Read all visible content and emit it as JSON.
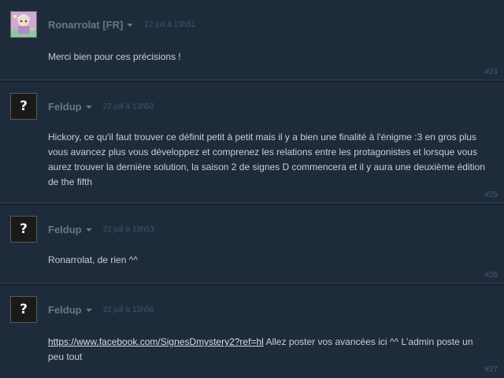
{
  "posts": [
    {
      "author": "Ronarrolat [FR]",
      "timestamp": "22 juil à 13h51",
      "body": "Merci bien pour ces précisions !",
      "number": "#24",
      "avatar": "character-avatar"
    },
    {
      "author": "Feldup",
      "timestamp": "22 juil à 13h53",
      "body": "Hickory, ce qu'il faut trouver ce définit petit à petit mais il y a bien une finalité à l'énigme :3 en gros plus vous avancez plus vous développez et comprenez les relations entre les protagonistes et lorsque vous aurez trouver la dernière solution, la saison 2 de signes D commencera et il y aura une deuxième édition de the fifth",
      "number": "#25",
      "avatar": "question-mark-avatar",
      "avatar_glyph": "?"
    },
    {
      "author": "Feldup",
      "timestamp": "22 juil à 13h53",
      "body": "Ronarrolat, de rien ^^",
      "number": "#26",
      "avatar": "question-mark-avatar",
      "avatar_glyph": "?"
    },
    {
      "author": "Feldup",
      "timestamp": "22 juil à 13h56",
      "link": "https://www.facebook.com/SignesDmystery2?ref=hl",
      "body_after_link": " Allez poster vos avancées ici ^^ L'admin poste un peu tout",
      "number": "#27",
      "avatar": "question-mark-avatar",
      "avatar_glyph": "?"
    }
  ],
  "colors": {
    "background": "#1b2838",
    "post_background": "#1e2b3b",
    "author": "#6a7785",
    "body_text": "#c7ced6",
    "timestamp": "#475466",
    "post_number": "#4a5b70"
  }
}
